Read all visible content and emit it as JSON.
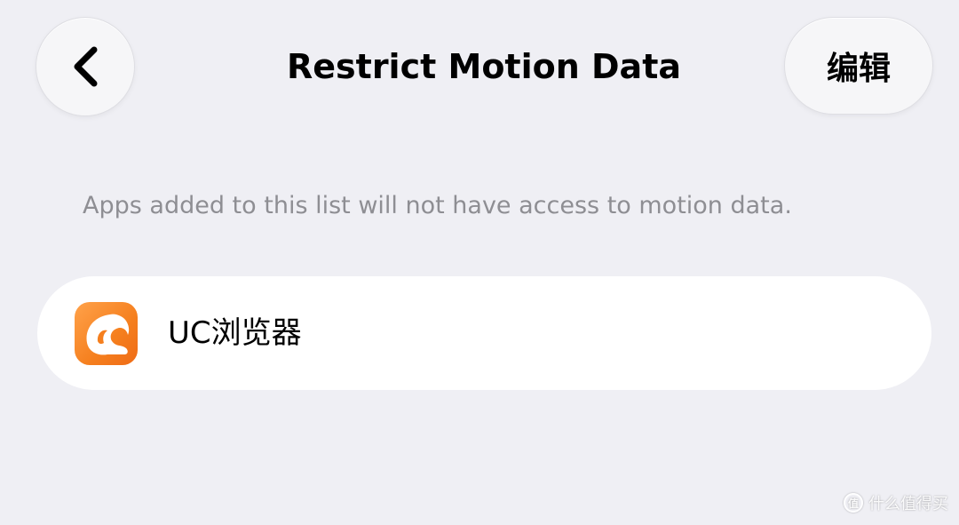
{
  "nav": {
    "back_icon": "chevron-left-icon",
    "title": "Restrict Motion Data",
    "edit_label": "编辑"
  },
  "description": "Apps added to this list will not have access to motion data.",
  "app_list": [
    {
      "name": "UC浏览器",
      "icon": "uc-browser-icon",
      "icon_color": "#f57f1e"
    }
  ],
  "watermark": {
    "logo_text": "值",
    "text": "什么值得买"
  },
  "colors": {
    "background": "#efeff4",
    "card": "#ffffff",
    "secondary_text": "#8e8e93"
  }
}
